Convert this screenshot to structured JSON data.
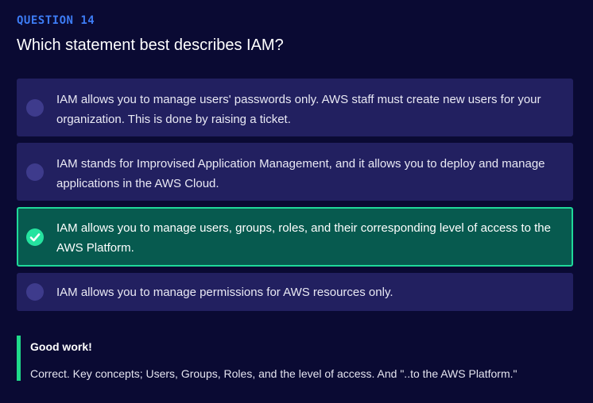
{
  "question": {
    "number_label": "QUESTION 14",
    "title": "Which statement best describes IAM?"
  },
  "options": [
    {
      "text": "IAM allows you to manage users' passwords only. AWS staff must create new users for your organization. This is done by raising a ticket.",
      "selected": false
    },
    {
      "text": "IAM stands for Improvised Application Management, and it allows you to deploy and manage applications in the AWS Cloud.",
      "selected": false
    },
    {
      "text": "IAM allows you to manage users, groups, roles, and their corresponding level of access to the AWS Platform.",
      "selected": true
    },
    {
      "text": "IAM allows you to manage permissions for AWS resources only.",
      "selected": false
    }
  ],
  "feedback": {
    "title": "Good work!",
    "text": "Correct. Key concepts; Users, Groups, Roles, and the level of access. And \"..to the AWS Platform.\""
  },
  "colors": {
    "background": "#0a0a33",
    "accent": "#3d7cf5",
    "option_bg": "#222060",
    "selected_bg": "#075a4f",
    "selected_border": "#1fd99a",
    "feedback_bar": "#1fd98a"
  },
  "icons": {
    "selected_option": "check-circle-icon",
    "unselected_option": "radio-circle-icon"
  }
}
